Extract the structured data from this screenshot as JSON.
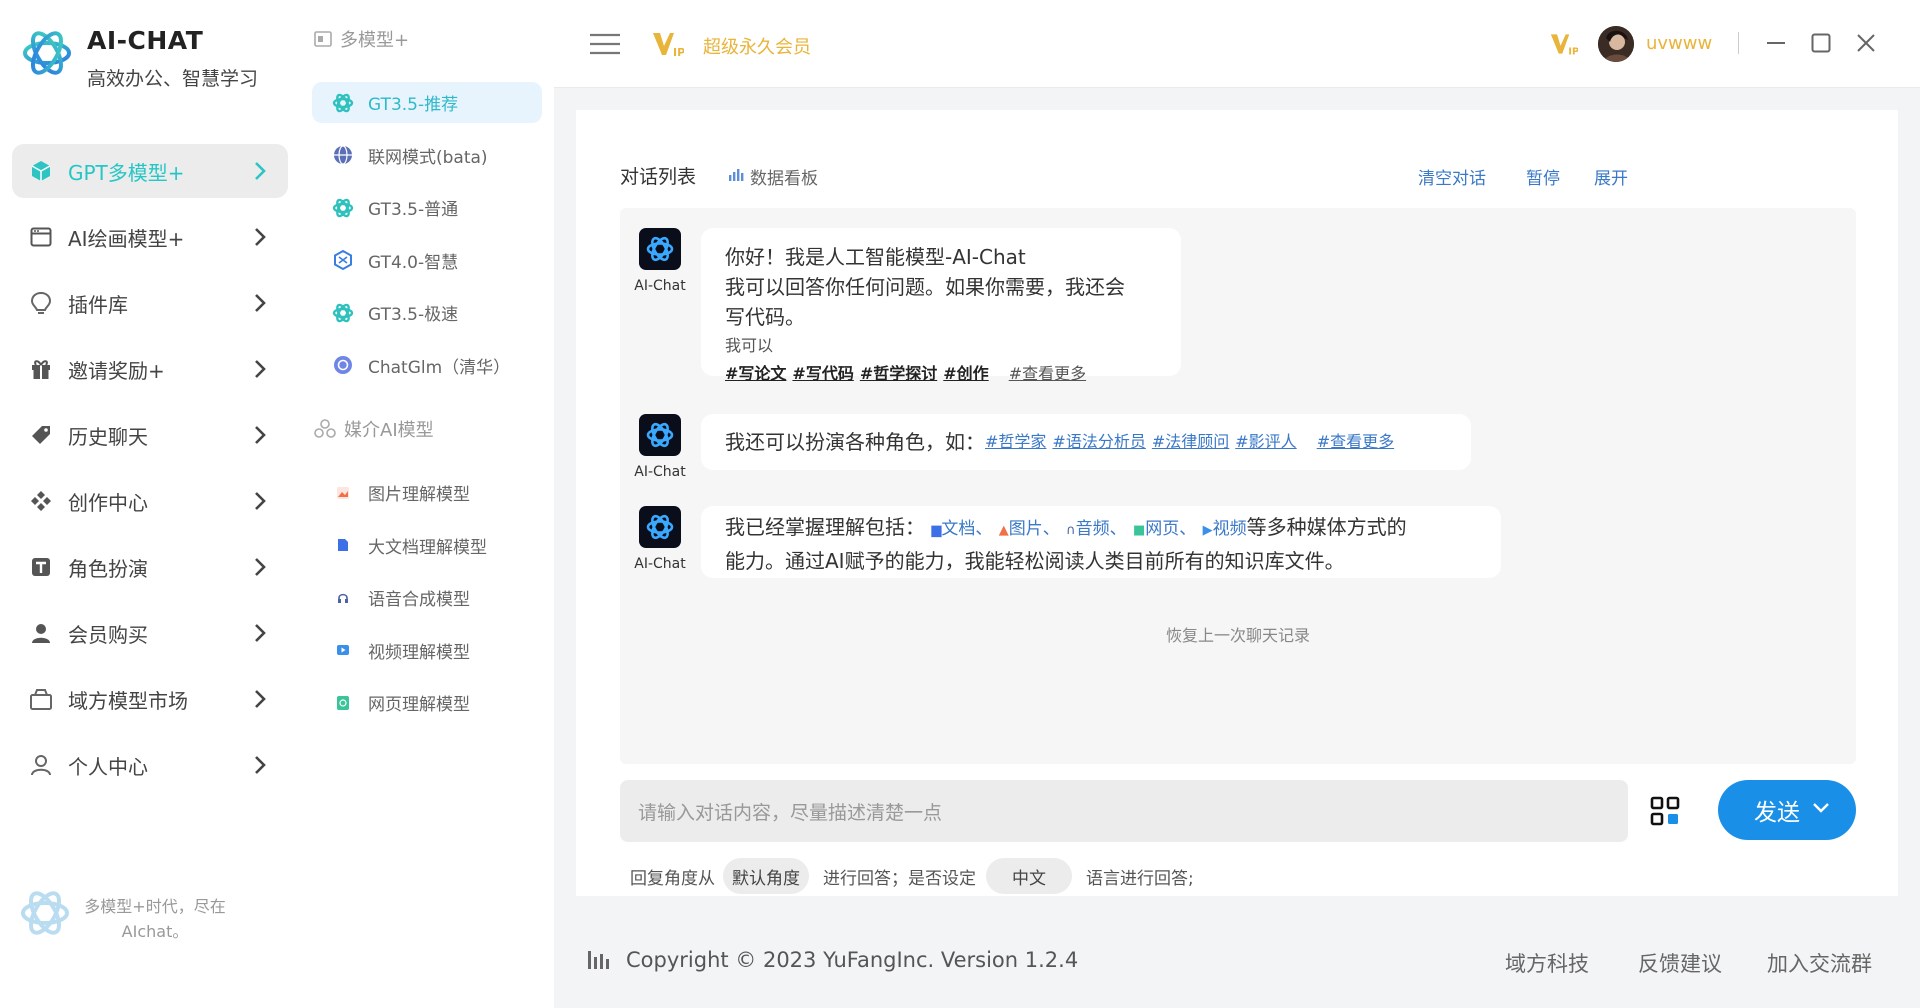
{
  "app": {
    "name": "AI-CHAT",
    "tagline": "高效办公、智慧学习"
  },
  "sidebar": {
    "items": [
      {
        "label": "GPT多模型+",
        "icon": "cube-icon",
        "active": true
      },
      {
        "label": "AI绘画模型+",
        "icon": "window-icon"
      },
      {
        "label": "插件库",
        "icon": "bulb-icon"
      },
      {
        "label": "邀请奖励+",
        "icon": "gift-icon"
      },
      {
        "label": "历史聊天",
        "icon": "tag-icon"
      },
      {
        "label": "创作中心",
        "icon": "diamond-grid-icon"
      },
      {
        "label": "角色扮演",
        "icon": "text-t-icon"
      },
      {
        "label": "会员购买",
        "icon": "person-solid-icon"
      },
      {
        "label": "域方模型市场",
        "icon": "bag-icon"
      },
      {
        "label": "个人中心",
        "icon": "person-outline-icon"
      }
    ],
    "footer_text": "多模型+时代，尽在AIchat。"
  },
  "models": {
    "section1_title": "多模型+",
    "section2_title": "媒介AI模型",
    "chat_models": [
      {
        "label": "GT3.5-推荐",
        "icon": "openai-icon",
        "active": true
      },
      {
        "label": "联网模式(bata)",
        "icon": "globe-icon"
      },
      {
        "label": "GT3.5-普通",
        "icon": "openai-icon"
      },
      {
        "label": "GT4.0-智慧",
        "icon": "gt4-icon"
      },
      {
        "label": "GT3.5-极速",
        "icon": "openai-icon"
      },
      {
        "label": "ChatGlm（清华）",
        "icon": "chatglm-icon"
      }
    ],
    "media_models": [
      {
        "label": "图片理解模型",
        "icon": "image-icon"
      },
      {
        "label": "大文档理解模型",
        "icon": "doc-icon"
      },
      {
        "label": "语音合成模型",
        "icon": "headphone-icon"
      },
      {
        "label": "视频理解模型",
        "icon": "video-icon"
      },
      {
        "label": "网页理解模型",
        "icon": "webpage-icon"
      }
    ]
  },
  "topbar": {
    "vip_label": "超级永久会员",
    "username": "uvwww",
    "colors": {
      "vip": "#e9b43a"
    }
  },
  "chat": {
    "tab_list": "对话列表",
    "tab_dashboard": "数据看板",
    "action_clear": "清空对话",
    "action_pause": "暂停",
    "action_expand": "展开",
    "bot_name": "AI-Chat",
    "msg1": {
      "line1": "你好！我是人工智能模型-AI-Chat",
      "line2": "我可以回答你任何问题。如果你需要，我还会",
      "line3": "写代码。",
      "can_label": "我可以",
      "tags": [
        "#写论文",
        "#写代码",
        "#哲学探讨",
        "#创作"
      ],
      "more": "#查看更多"
    },
    "msg2": {
      "text": "我还可以扮演各种角色，如：",
      "tags": [
        "#哲学家",
        "#语法分析员",
        "#法律顾问",
        "#影评人"
      ],
      "more": "#查看更多"
    },
    "msg3": {
      "prefix": "我已经掌握理解包括：",
      "media": [
        "文档、",
        "图片、",
        "音频、",
        "网页、",
        "视频"
      ],
      "suffix": "等多种媒体方式的",
      "line2": "能力。通过AI赋予的能力，我能轻松阅读人类目前所有的知识库文件。"
    },
    "restore": "恢复上一次聊天记录",
    "input_placeholder": "请输入对话内容，尽量描述清楚一点",
    "send_label": "发送",
    "opt_prefix": "回复角度从",
    "opt_angle": "默认角度",
    "opt_middle": "进行回答；是否设定",
    "opt_lang": "中文",
    "opt_suffix": "语言进行回答;"
  },
  "footer": {
    "copyright": "Copyright © 2023 YuFangInc. Version 1.2.4",
    "links": [
      "域方科技",
      "反馈建议",
      "加入交流群"
    ]
  }
}
